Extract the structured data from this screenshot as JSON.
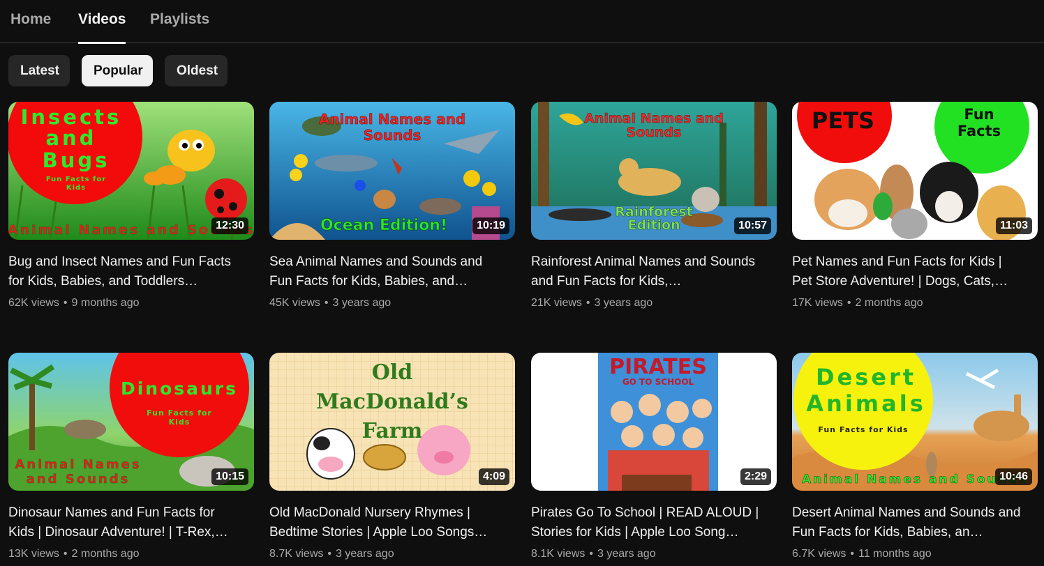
{
  "tabs": [
    {
      "label": "Home"
    },
    {
      "label": "Videos"
    },
    {
      "label": "Playlists"
    }
  ],
  "active_tab": "Videos",
  "chips": [
    {
      "label": "Latest"
    },
    {
      "label": "Popular"
    },
    {
      "label": "Oldest"
    }
  ],
  "selected_chip": "Popular",
  "videos": [
    {
      "title": "Bug and Insect Names and Fun Facts for Kids, Babies, and Toddlers…",
      "views": "62K views",
      "age": "9 months ago",
      "duration": "12:30",
      "thumb_text": {
        "circle": "Insects\nand\nBugs",
        "sub": "Fun Facts for\nKids",
        "bottom": "Animal Names and Sounds"
      }
    },
    {
      "title": "Sea Animal Names and Sounds and Fun Facts for Kids, Babies, and…",
      "views": "45K views",
      "age": "3 years ago",
      "duration": "10:19",
      "thumb_text": {
        "top": "Animal Names and\nSounds",
        "bottom": "Ocean Edition!"
      }
    },
    {
      "title": "Rainforest Animal Names and Sounds and Fun Facts for Kids,…",
      "views": "21K views",
      "age": "3 years ago",
      "duration": "10:57",
      "thumb_text": {
        "top": "Animal Names and\nSounds",
        "bottom": "Rainforest\nEdition"
      }
    },
    {
      "title": "Pet Names and Fun Facts for Kids | Pet Store Adventure! | Dogs, Cats,…",
      "views": "17K views",
      "age": "2 months ago",
      "duration": "11:03",
      "thumb_text": {
        "left": "PETS",
        "right": "Fun\nFacts"
      }
    },
    {
      "title": "Dinosaur Names and Fun Facts for Kids | Dinosaur Adventure! | T-Rex,…",
      "views": "13K views",
      "age": "2 months ago",
      "duration": "10:15",
      "thumb_text": {
        "circle": "Dinosaurs",
        "sub": "Fun Facts for\nKids",
        "bottom": "Animal Names\nand Sounds"
      }
    },
    {
      "title": "Old MacDonald Nursery Rhymes | Bedtime Stories | Apple Loo Songs…",
      "views": "8.7K views",
      "age": "3 years ago",
      "duration": "4:09",
      "thumb_text": {
        "top": "Old\nMacDonald’s\nFarm"
      }
    },
    {
      "title": "Pirates Go To School | READ ALOUD | Stories for Kids | Apple Loo Song…",
      "views": "8.1K views",
      "age": "3 years ago",
      "duration": "2:29",
      "thumb_text": {
        "top": "PIRATES",
        "sub": "GO TO SCHOOL"
      }
    },
    {
      "title": "Desert Animal Names and Sounds and Fun Facts for Kids, Babies, an…",
      "views": "6.7K views",
      "age": "11 months ago",
      "duration": "10:46",
      "thumb_text": {
        "circle": "Desert\nAnimals",
        "sub": "Fun Facts for Kids",
        "bottom": "Animal Names and Sounds"
      }
    }
  ],
  "colors": {
    "background": "#0f0f0f",
    "text": "#f1f1f1",
    "muted": "#aaaaaa",
    "chip": "#272727",
    "chip_selected": "#f1f1f1"
  }
}
